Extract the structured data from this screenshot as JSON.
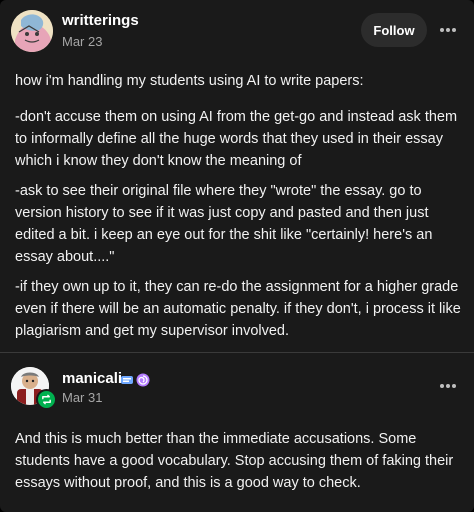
{
  "post": {
    "author": "writterings",
    "date": "Mar 23",
    "follow_label": "Follow",
    "paragraphs": [
      "how i'm handling my students using AI to write papers:",
      "-don't accuse them on using AI from the get-go and instead ask them to informally define all the huge words that they used in their essay which i know they don't know the meaning of",
      "-ask to see their original file where they \"wrote\" the essay. go to version history to see if it was just copy and pasted and then just edited a bit. i keep an eye out for the shit like \"certainly! here's an essay about....\"",
      "-if they own up to it, they can re-do the assignment for a higher grade even if there will be an automatic penalty. if they don't, i process it like plagiarism and get my supervisor involved."
    ]
  },
  "reply": {
    "author": "manicali",
    "date": "Mar 31",
    "text": "And this is much better than the immediate accusations. Some students have a good vocabulary. Stop accusing them of faking their essays without proof, and this is a good way to check."
  },
  "colors": {
    "background": "#1a1a1a",
    "text": "#ffffff",
    "muted": "#a6a6a6",
    "reblog_green": "#00b04f"
  },
  "icons": {
    "more": "more-horizontal-icon",
    "reblog": "reblog-icon",
    "badges": [
      "tag-badge-icon",
      "spiral-badge-icon"
    ]
  }
}
